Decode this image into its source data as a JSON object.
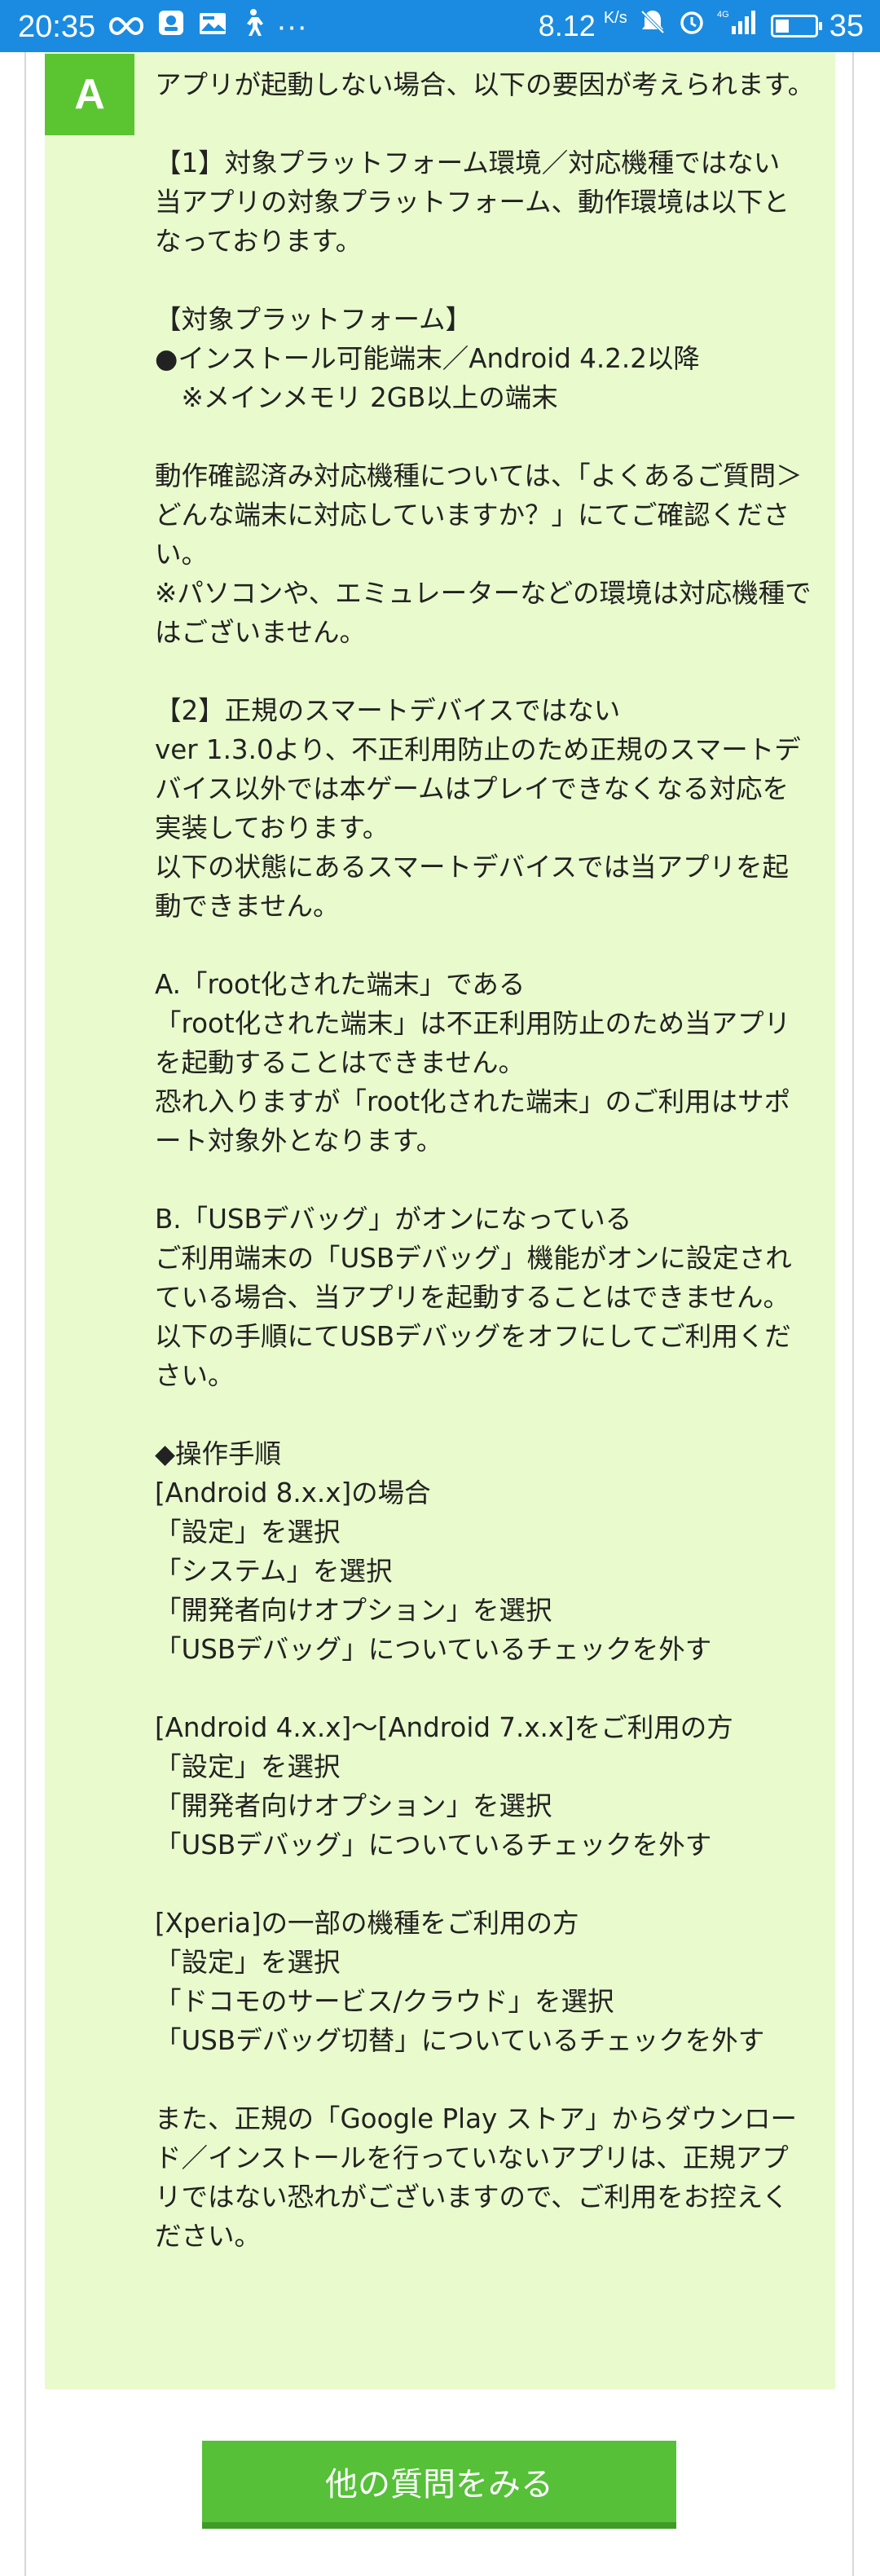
{
  "status_bar": {
    "time": "20:35",
    "dots": "···",
    "speed": "8.12",
    "speed_unit": "K/s",
    "network": "4G",
    "battery": "35",
    "battery_level": 0.35
  },
  "answer": {
    "badge": "A",
    "text": "アプリが起動しない場合、以下の要因が考えられます。\n\n【1】対象プラットフォーム環境／対応機種ではない\n当アプリの対象プラットフォーム、動作環境は以下となっております。\n\n【対象プラットフォーム】\n●インストール可能端末／Android 4.2.2以降\n　※メインメモリ 2GB以上の端末\n\n動作確認済み対応機種については、「よくあるご質問＞どんな端末に対応していますか？」にてご確認ください。\n※パソコンや、エミュレーターなどの環境は対応機種ではございません。\n\n【2】正規のスマートデバイスではない\nver 1.3.0より、不正利用防止のため正規のスマートデバイス以外では本ゲームはプレイできなくなる対応を実装しております。\n以下の状態にあるスマートデバイスでは当アプリを起動できません。\n\nA.「root化された端末」である\n「root化された端末」は不正利用防止のため当アプリを起動することはできません。\n恐れ入りますが「root化された端末」のご利用はサポート対象外となります。\n\nB.「USBデバッグ」がオンになっている\nご利用端末の「USBデバッグ」機能がオンに設定されている場合、当アプリを起動することはできません。以下の手順にてUSBデバッグをオフにしてご利用ください。\n\n◆操作手順\n[Android 8.x.x]の場合\n「設定」を選択\n「システム」を選択\n「開発者向けオプション」を選択\n「USBデバッグ」についているチェックを外す\n\n[Android 4.x.x]〜[Android 7.x.x]をご利用の方\n「設定」を選択\n「開発者向けオプション」を選択\n「USBデバッグ」についているチェックを外す\n\n[Xperia]の一部の機種をご利用の方\n「設定」を選択\n「ドコモのサービス/クラウド」を選択\n「USBデバッグ切替」についているチェックを外す\n\nまた、正規の「Google Play ストア」からダウンロード／インストールを行っていないアプリは、正規アプリではない恐れがございますので、ご利用をお控えください。"
  },
  "buttons": {
    "more_questions": "他の質問をみる"
  },
  "colors": {
    "status_bar": "#1a8be0",
    "answer_bg": "#e9fbcd",
    "accent_green": "#5ac530"
  }
}
